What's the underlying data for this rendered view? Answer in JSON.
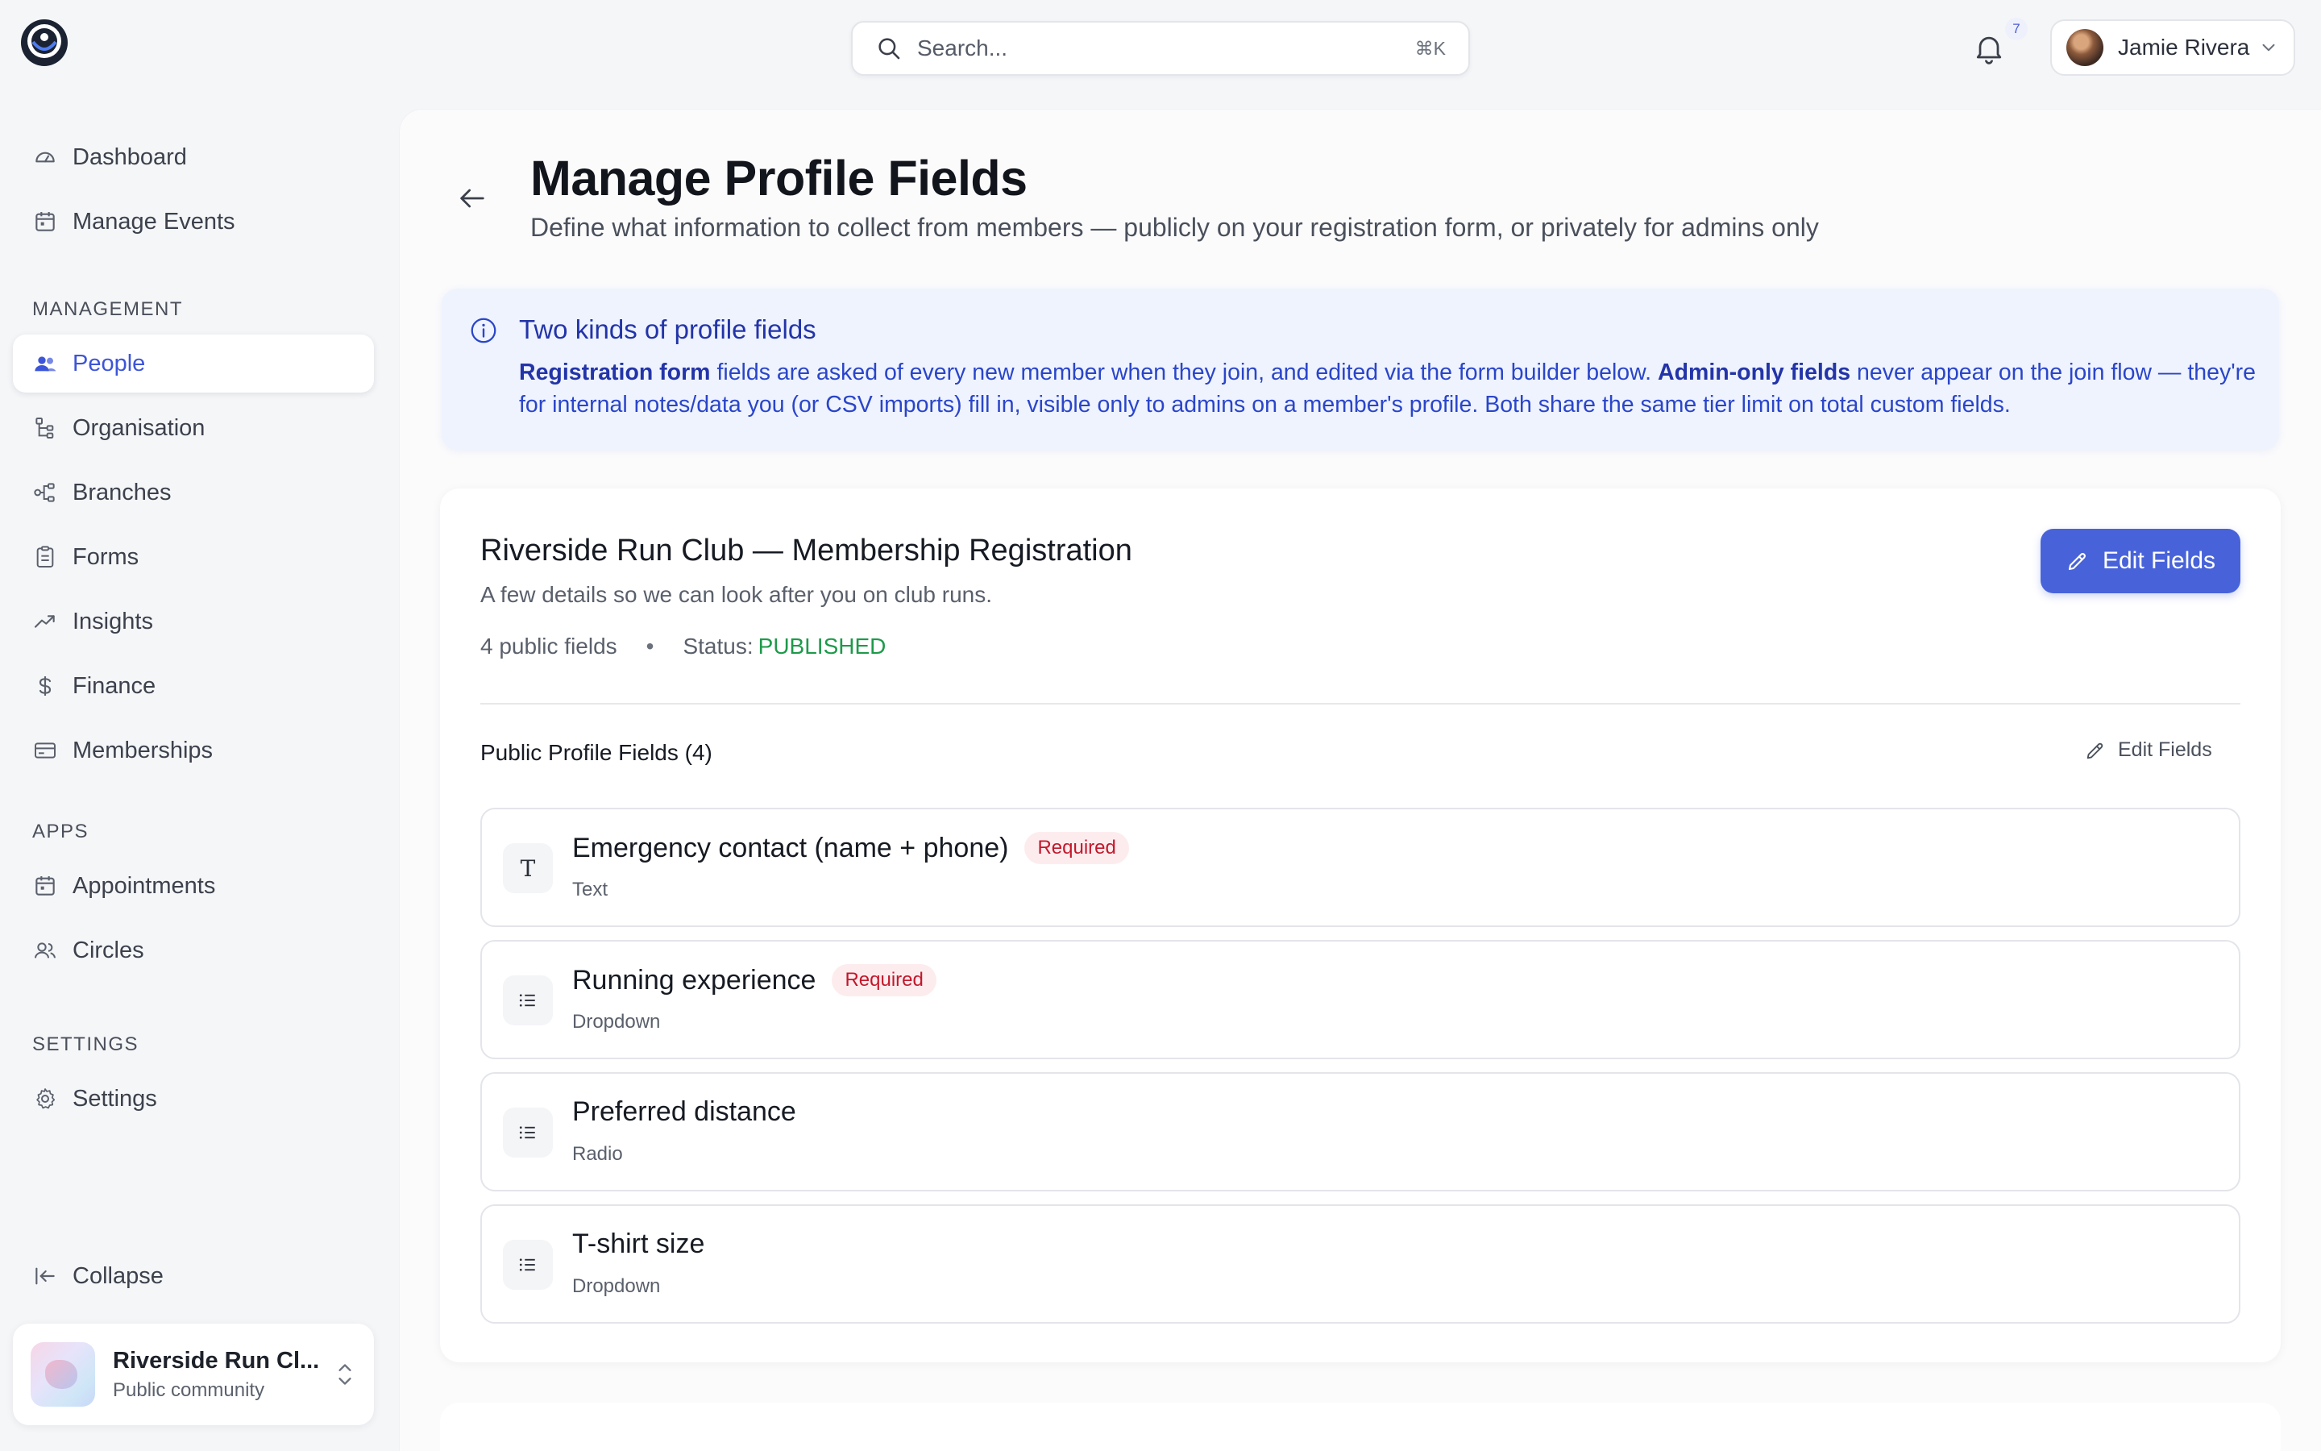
{
  "app": {
    "logo": "eye-logo"
  },
  "search": {
    "placeholder": "Search...",
    "shortcut": "⌘K"
  },
  "notifications": {
    "count": "7"
  },
  "user": {
    "name": "Jamie Rivera"
  },
  "sidebar": {
    "top_items": [
      {
        "label": "Dashboard",
        "icon": "gauge-icon"
      },
      {
        "label": "Manage Events",
        "icon": "calendar-icon"
      }
    ],
    "management_heading": "MANAGEMENT",
    "management_items": [
      {
        "label": "People",
        "icon": "people-icon",
        "active": true
      },
      {
        "label": "Organisation",
        "icon": "org-tree-icon"
      },
      {
        "label": "Branches",
        "icon": "branches-icon"
      },
      {
        "label": "Forms",
        "icon": "clipboard-icon"
      },
      {
        "label": "Insights",
        "icon": "trend-icon"
      },
      {
        "label": "Finance",
        "icon": "dollar-icon"
      },
      {
        "label": "Memberships",
        "icon": "card-icon"
      }
    ],
    "apps_heading": "APPS",
    "apps_items": [
      {
        "label": "Appointments",
        "icon": "calendar-icon"
      },
      {
        "label": "Circles",
        "icon": "users-icon"
      }
    ],
    "settings_heading": "SETTINGS",
    "settings_items": [
      {
        "label": "Settings",
        "icon": "gear-icon"
      }
    ],
    "collapse_label": "Collapse",
    "org": {
      "name": "Riverside Run Cl...",
      "subtitle": "Public community"
    }
  },
  "page": {
    "title": "Manage Profile Fields",
    "subtitle": "Define what information to collect from members — publicly on your registration form, or privately for admins only"
  },
  "info": {
    "title": "Two kinds of profile fields",
    "bold1": "Registration form",
    "text1": " fields are asked of every new member when they join, and edited via the form builder below. ",
    "bold2": "Admin-only fields",
    "text2": " never appear on the join flow — they're for internal notes/data you (or CSV imports) fill in, visible only to admins on a member's profile. Both share the same tier limit on total custom fields."
  },
  "form_card": {
    "title": "Riverside Run Club — Membership Registration",
    "description": "A few details so we can look after you on club runs.",
    "field_count": "4 public fields",
    "status_label": "Status:",
    "status_value": "PUBLISHED",
    "status_color": "#1d9a4a",
    "edit_button": "Edit Fields",
    "accent_color": "#4863d9",
    "section_label": "Public Profile Fields (4)",
    "edit_link": "Edit Fields",
    "fields": [
      {
        "name": "Emergency contact (name + phone)",
        "type": "Text",
        "required": "Required",
        "icon": "text-type-icon"
      },
      {
        "name": "Running experience",
        "type": "Dropdown",
        "required": "Required",
        "icon": "list-icon"
      },
      {
        "name": "Preferred distance",
        "type": "Radio",
        "required": "",
        "icon": "list-icon"
      },
      {
        "name": "T-shirt size",
        "type": "Dropdown",
        "required": "",
        "icon": "list-icon"
      }
    ]
  }
}
